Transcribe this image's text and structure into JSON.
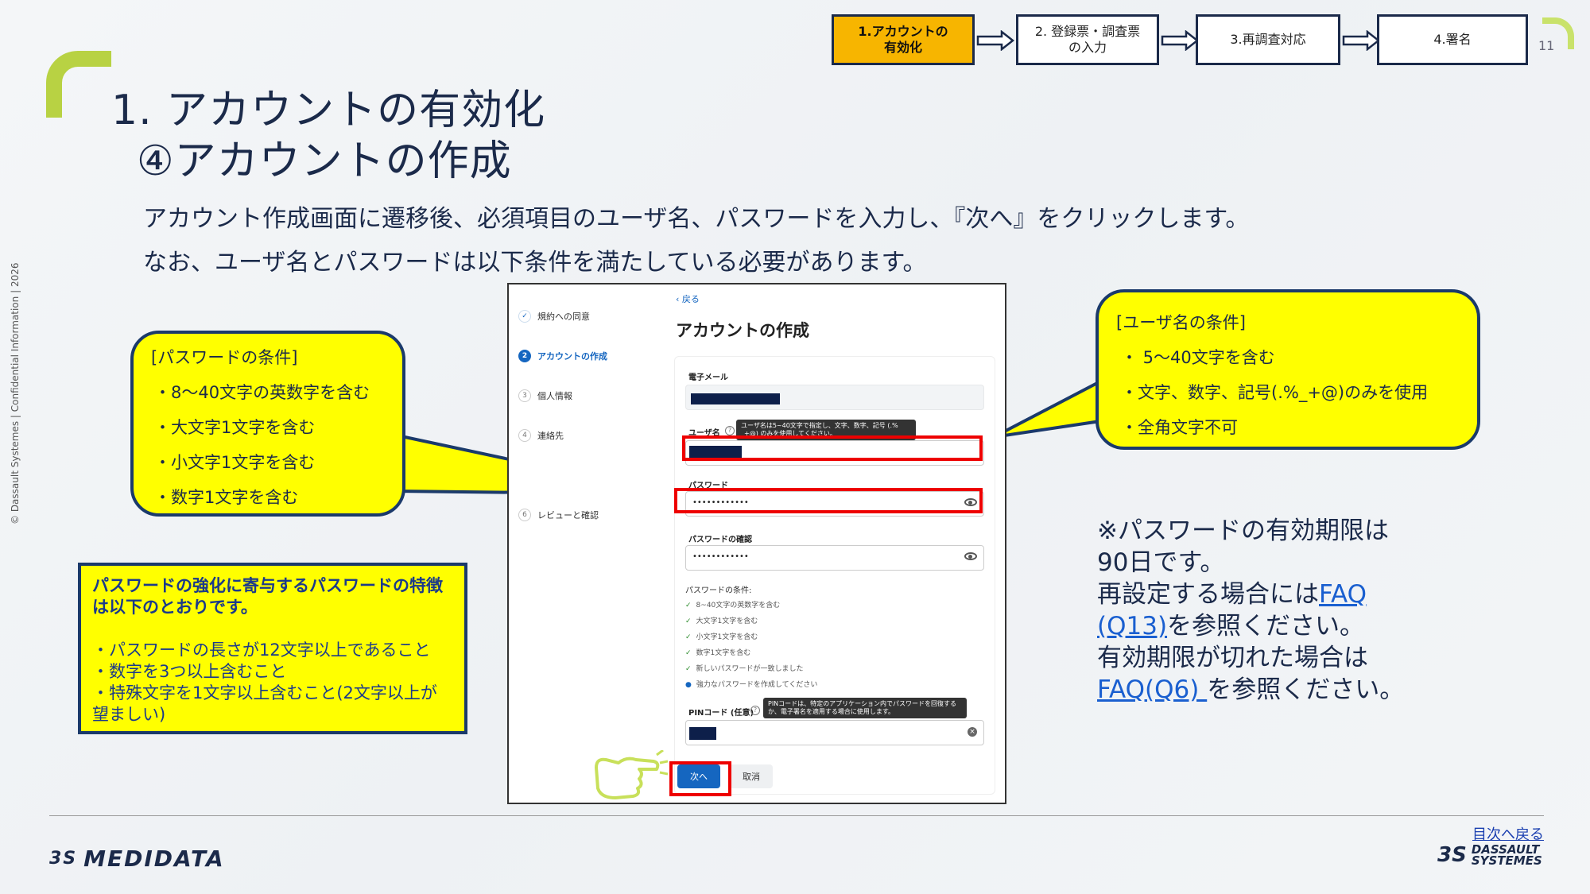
{
  "header": {
    "steps": [
      {
        "label_line1": "1.アカウントの",
        "label_line2": "有効化",
        "active": true
      },
      {
        "label_line1": "2. 登録票・調査票",
        "label_line2": "の入力",
        "active": false
      },
      {
        "label_line1": "3.再調査対応",
        "label_line2": "",
        "active": false
      },
      {
        "label_line1": "4.署名",
        "label_line2": "",
        "active": false
      }
    ],
    "slide_number": "11"
  },
  "title": {
    "line1": "1. アカウントの有効化",
    "line2": "④アカウントの作成"
  },
  "description": {
    "line1": "アカウント作成画面に遷移後、必須項目のユーザ名、パスワードを入力し、『次へ』をクリックします。",
    "line2": "なお、ユーザ名とパスワードは以下条件を満たしている必要があります。"
  },
  "side_text": "© Dassault Systemes | Confidential Information | 2026",
  "password_callout": {
    "heading": "[パスワードの条件]",
    "items": [
      "・8～40文字の英数字を含む",
      "・大文字1文字を含む",
      "・小文字1文字を含む",
      "・数字1文字を含む"
    ]
  },
  "username_callout": {
    "heading": "[ユーザ名の条件]",
    "items": [
      "・ 5～40文字を含む",
      "・文字、数字、記号(.%_+@)のみを使用",
      "・全角文字不可"
    ]
  },
  "info_box": {
    "heading_line1": "パスワードの強化に寄与するパスワードの特徴",
    "heading_line2": "は以下のとおりです。",
    "items": [
      "・パスワードの長さが12文字以上であること",
      "・数字を3つ以上含むこと",
      "・特殊文字を1文字以上含むこと(2文字以上が",
      "望ましい)"
    ]
  },
  "screenshot": {
    "back_link": "‹ 戻る",
    "heading": "アカウントの作成",
    "sidebar": [
      {
        "num": "✓",
        "label": "規約への同意",
        "state": "done"
      },
      {
        "num": "2",
        "label": "アカウントの作成",
        "state": "current"
      },
      {
        "num": "3",
        "label": "個人情報",
        "state": "todo"
      },
      {
        "num": "4",
        "label": "連絡先",
        "state": "todo"
      },
      {
        "num": "6",
        "label": "レビューと確認",
        "state": "todo"
      }
    ],
    "email_label": "電子メール",
    "username_label": "ユーザ名",
    "username_tooltip": "ユーザ名は5~40文字で指定し、文字、数字、記号 (.% _+@) のみを使用してください。",
    "password_label": "パスワード",
    "password_value": "••••••••••••",
    "confirm_label": "パスワードの確認",
    "confirm_value": "••••••••••••",
    "conditions_title": "パスワードの条件:",
    "conditions": [
      "8~40文字の英数字を含む",
      "大文字1文字を含む",
      "小文字1文字を含む",
      "数字1文字を含む",
      "新しいパスワードが一致しました",
      "強力なパスワードを作成してください"
    ],
    "pin_label": "PINコード (任意)",
    "pin_tooltip": "PINコードは、特定のアプリケーション内でパスワードを回復するか、電子署名を適用する場合に使用します。",
    "next_button": "次へ",
    "cancel_button": "取消"
  },
  "note": {
    "line1": "※パスワードの有効期限は",
    "line2": "90日です。",
    "line3_pre": "再設定する場合には",
    "line3_link": "FAQ",
    "line4_link": "(Q13)",
    "line4_post": "を参照ください。",
    "line5": "有効期限が切れた場合は",
    "line6_link": "FAQ(Q6) ",
    "line6_post": "を参照ください。"
  },
  "footer": {
    "toc_link": "目次へ戻る",
    "brand_left": "MEDIDATA",
    "brand_right_line1": "DASSAULT",
    "brand_right_line2": "SYSTEMES"
  },
  "colors": {
    "navy": "#1b2a4a",
    "highlight_yellow": "#ffff00",
    "active_step": "#f7b500",
    "accent_green": "#b8d243",
    "red_highlight": "#e00000",
    "link_blue": "#1a5fd0",
    "button_blue": "#1566c0"
  }
}
